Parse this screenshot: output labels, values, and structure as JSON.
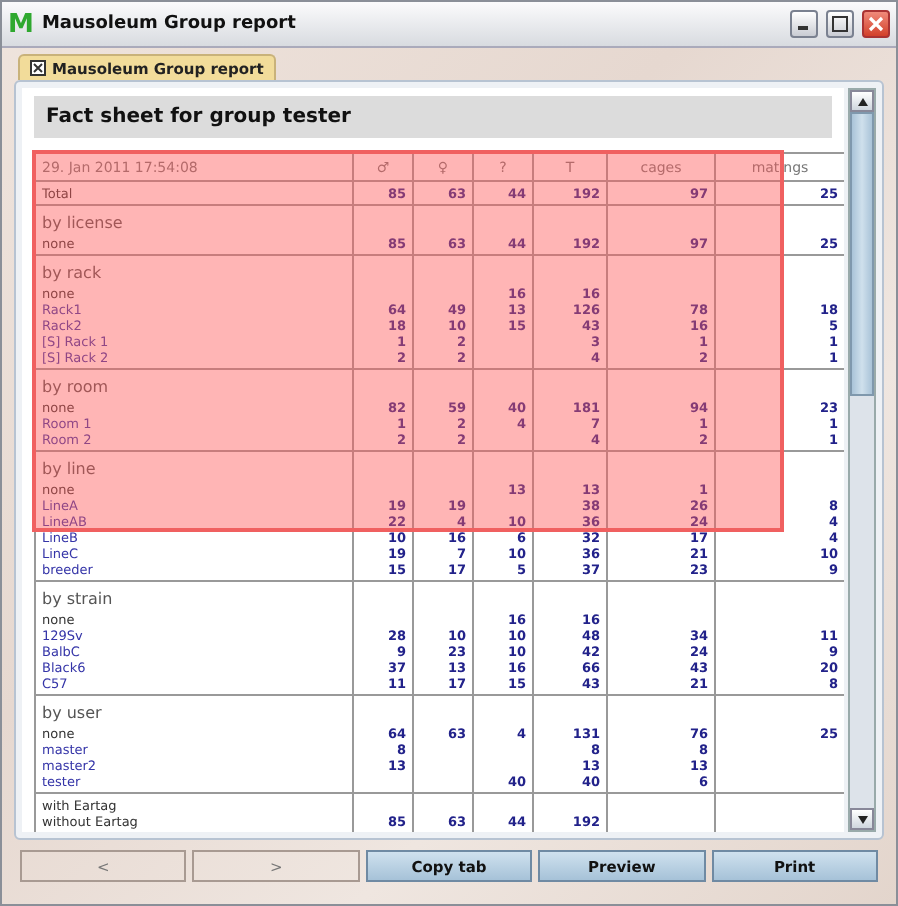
{
  "window": {
    "app_icon": "M",
    "title": "Mausoleum Group report"
  },
  "tabs": [
    {
      "label": "Mausoleum Group report",
      "selected": true
    }
  ],
  "heading": "Fact sheet for group tester",
  "table": {
    "columns": [
      "29. Jan 2011 17:54:08",
      "♂",
      "♀",
      "?",
      "T",
      "cages",
      "matings"
    ],
    "sections": [
      {
        "rows": [
          {
            "label": "Total",
            "link": false,
            "male": "85",
            "female": "63",
            "unknown": "44",
            "total": "192",
            "cages": "97",
            "matings": "25"
          }
        ]
      },
      {
        "title": "by license",
        "rows": [
          {
            "label": "none",
            "link": false,
            "male": "85",
            "female": "63",
            "unknown": "44",
            "total": "192",
            "cages": "97",
            "matings": "25"
          }
        ]
      },
      {
        "title": "by rack",
        "rows": [
          {
            "label": "none",
            "link": false,
            "unknown": "16",
            "total": "16"
          },
          {
            "label": "Rack1",
            "link": true,
            "male": "64",
            "female": "49",
            "unknown": "13",
            "total": "126",
            "cages": "78",
            "matings": "18"
          },
          {
            "label": "Rack2",
            "link": true,
            "male": "18",
            "female": "10",
            "unknown": "15",
            "total": "43",
            "cages": "16",
            "matings": "5"
          },
          {
            "label": "[S] Rack 1",
            "link": true,
            "male": "1",
            "female": "2",
            "total": "3",
            "cages": "1",
            "matings": "1"
          },
          {
            "label": "[S] Rack 2",
            "link": true,
            "male": "2",
            "female": "2",
            "total": "4",
            "cages": "2",
            "matings": "1"
          }
        ]
      },
      {
        "title": "by room",
        "rows": [
          {
            "label": "none",
            "link": false,
            "male": "82",
            "female": "59",
            "unknown": "40",
            "total": "181",
            "cages": "94",
            "matings": "23"
          },
          {
            "label": "Room 1",
            "link": true,
            "male": "1",
            "female": "2",
            "unknown": "4",
            "total": "7",
            "cages": "1",
            "matings": "1"
          },
          {
            "label": "Room 2",
            "link": true,
            "male": "2",
            "female": "2",
            "total": "4",
            "cages": "2",
            "matings": "1"
          }
        ]
      },
      {
        "title": "by line",
        "rows": [
          {
            "label": "none",
            "link": false,
            "unknown": "13",
            "total": "13",
            "cages": "1"
          },
          {
            "label": "LineA",
            "link": true,
            "male": "19",
            "female": "19",
            "total": "38",
            "cages": "26",
            "matings": "8"
          },
          {
            "label": "LineAB",
            "link": true,
            "male": "22",
            "female": "4",
            "unknown": "10",
            "total": "36",
            "cages": "24",
            "matings": "4"
          },
          {
            "label": "LineB",
            "link": true,
            "male": "10",
            "female": "16",
            "unknown": "6",
            "total": "32",
            "cages": "17",
            "matings": "4"
          },
          {
            "label": "LineC",
            "link": true,
            "male": "19",
            "female": "7",
            "unknown": "10",
            "total": "36",
            "cages": "21",
            "matings": "10"
          },
          {
            "label": "breeder",
            "link": true,
            "male": "15",
            "female": "17",
            "unknown": "5",
            "total": "37",
            "cages": "23",
            "matings": "9"
          }
        ]
      },
      {
        "title": "by strain",
        "rows": [
          {
            "label": "none",
            "link": false,
            "unknown": "16",
            "total": "16"
          },
          {
            "label": "129Sv",
            "link": true,
            "male": "28",
            "female": "10",
            "unknown": "10",
            "total": "48",
            "cages": "34",
            "matings": "11"
          },
          {
            "label": "BalbC",
            "link": true,
            "male": "9",
            "female": "23",
            "unknown": "10",
            "total": "42",
            "cages": "24",
            "matings": "9"
          },
          {
            "label": "Black6",
            "link": true,
            "male": "37",
            "female": "13",
            "unknown": "16",
            "total": "66",
            "cages": "43",
            "matings": "20"
          },
          {
            "label": "C57",
            "link": true,
            "male": "11",
            "female": "17",
            "unknown": "15",
            "total": "43",
            "cages": "21",
            "matings": "8"
          }
        ]
      },
      {
        "title": "by user",
        "rows": [
          {
            "label": "none",
            "link": false,
            "male": "64",
            "female": "63",
            "unknown": "4",
            "total": "131",
            "cages": "76",
            "matings": "25"
          },
          {
            "label": "master",
            "link": true,
            "male": "8",
            "total": "8",
            "cages": "8"
          },
          {
            "label": "master2",
            "link": true,
            "male": "13",
            "total": "13",
            "cages": "13"
          },
          {
            "label": "tester",
            "link": true,
            "unknown": "40",
            "total": "40",
            "cages": "6"
          }
        ]
      },
      {
        "rows": [
          {
            "label": "with Eartag",
            "link": false
          },
          {
            "label": "without Eartag",
            "link": false,
            "male": "85",
            "female": "63",
            "unknown": "44",
            "total": "192"
          }
        ]
      }
    ]
  },
  "buttons": [
    {
      "label": "<",
      "disabled": true
    },
    {
      "label": ">",
      "disabled": true
    },
    {
      "label": "Copy tab",
      "disabled": false
    },
    {
      "label": "Preview",
      "disabled": false
    },
    {
      "label": "Print",
      "disabled": false
    }
  ]
}
